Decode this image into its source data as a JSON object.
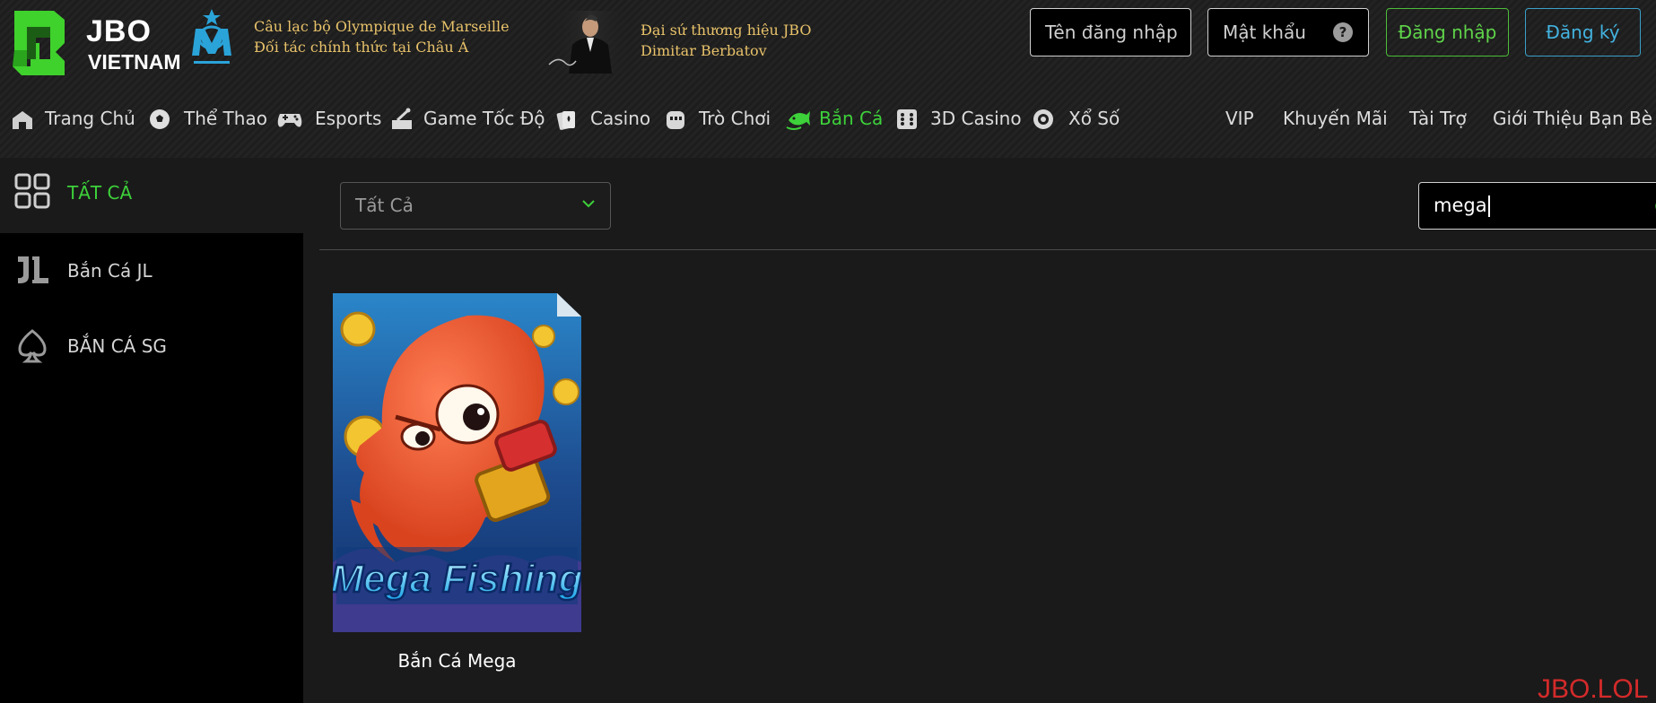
{
  "brand": {
    "name": "JBO",
    "sub": "VIETNAM"
  },
  "partner": {
    "line1": "Câu lạc bộ Olympique de Marseille",
    "line2": "Đối tác chính thức tại Châu Á"
  },
  "ambassador": {
    "line1": "Đại sứ thương hiệu JBO",
    "line2": "Dimitar Berbatov"
  },
  "auth": {
    "username_placeholder": "Tên đăng nhập",
    "password_placeholder": "Mật khẩu",
    "help": "?",
    "login_label": "Đăng nhập",
    "register_label": "Đăng ký"
  },
  "nav": {
    "home": "Trang Chủ",
    "sports": "Thể Thao",
    "esports": "Esports",
    "speed": "Game Tốc Độ",
    "casino": "Casino",
    "games": "Trò Chơi",
    "fishing": "Bắn Cá",
    "casino3d": "3D Casino",
    "lottery": "Xổ Số",
    "vip": "VIP",
    "promo": "Khuyến Mãi",
    "sponsor": "Tài Trợ",
    "referral": "Giới Thiệu Bạn Bè"
  },
  "sidebar": {
    "items": [
      {
        "label": "TẤT CẢ"
      },
      {
        "label": "Bắn Cá JL"
      },
      {
        "label": "BẮN CÁ SG"
      }
    ]
  },
  "filter": {
    "selected": "Tất Cả"
  },
  "search": {
    "value": "mega"
  },
  "games": [
    {
      "title": "Bắn Cá Mega",
      "thumb_text": "Mega Fishing"
    }
  ],
  "watermark": "JBO.LOL",
  "colors": {
    "accent_green": "#3dd13a",
    "register_blue": "#43b3e0",
    "gold_text": "#e8c26a",
    "watermark_red": "#d42a2a"
  }
}
